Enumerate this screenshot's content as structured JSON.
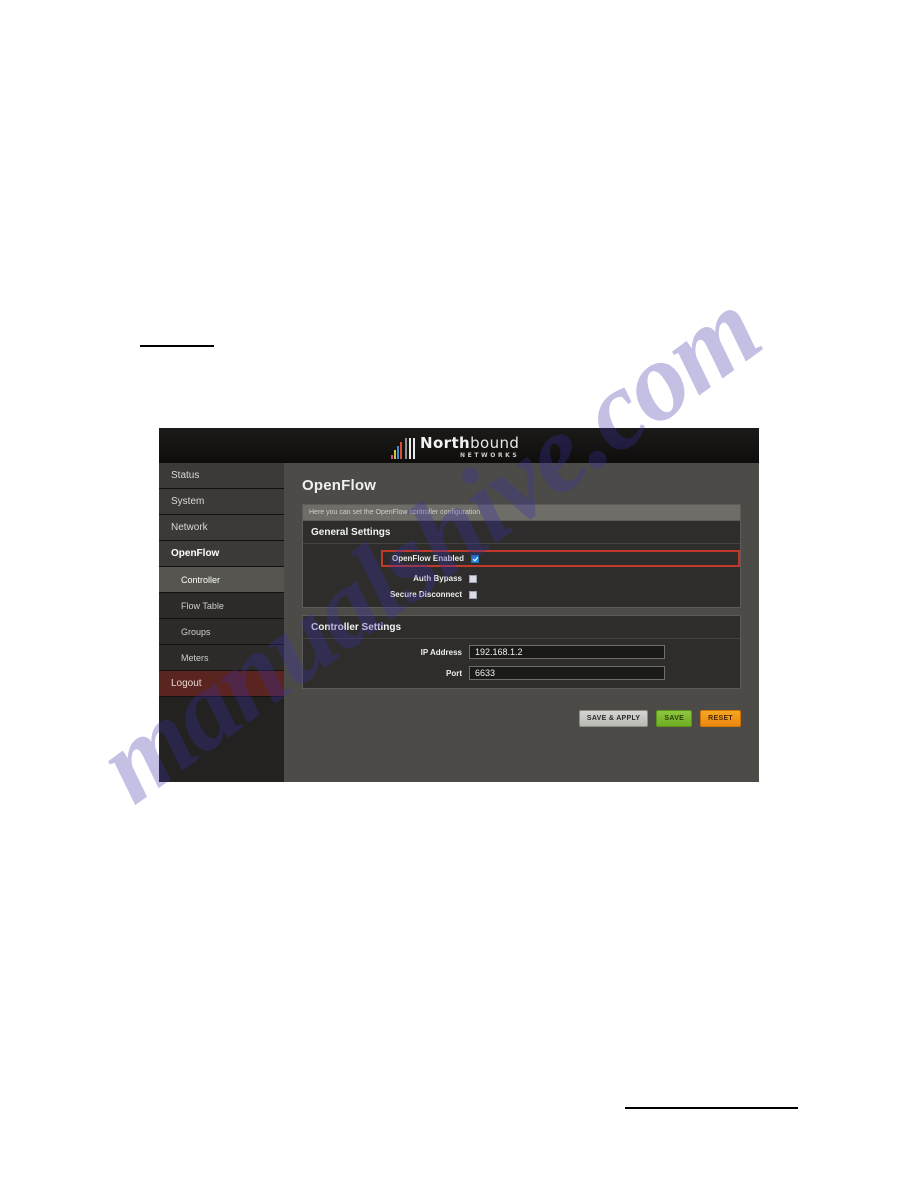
{
  "watermark": {
    "text": "manualshive.com"
  },
  "screenshot": {
    "header": {
      "brand_bold": "North",
      "brand_thin": "bound",
      "brand_sub": "NETWORKS",
      "logo_bars": [
        "#e2468f",
        "#b9cf3b",
        "#3a8fd4",
        "#e24b2e"
      ]
    },
    "sidebar": {
      "items": [
        {
          "label": "Status",
          "level": "top",
          "state": "normal"
        },
        {
          "label": "System",
          "level": "top",
          "state": "normal"
        },
        {
          "label": "Network",
          "level": "top",
          "state": "normal"
        },
        {
          "label": "OpenFlow",
          "level": "top",
          "state": "active"
        },
        {
          "label": "Controller",
          "level": "sub",
          "state": "active"
        },
        {
          "label": "Flow Table",
          "level": "sub",
          "state": "normal"
        },
        {
          "label": "Groups",
          "level": "sub",
          "state": "normal"
        },
        {
          "label": "Meters",
          "level": "sub",
          "state": "normal"
        },
        {
          "label": "Logout",
          "level": "top",
          "state": "logout"
        }
      ]
    },
    "main": {
      "page_title": "OpenFlow",
      "hint": "Here you can set the OpenFlow controller configuration",
      "general_settings": {
        "title": "General Settings",
        "fields": [
          {
            "label": "OpenFlow Enabled",
            "checked": true,
            "highlighted": true
          },
          {
            "label": "Auth Bypass",
            "checked": false,
            "highlighted": false
          },
          {
            "label": "Secure Disconnect",
            "checked": false,
            "highlighted": false
          }
        ]
      },
      "controller_settings": {
        "title": "Controller Settings",
        "fields": [
          {
            "label": "IP Address",
            "value": "192.168.1.2"
          },
          {
            "label": "Port",
            "value": "6633"
          }
        ]
      },
      "buttons": [
        {
          "label": "SAVE & APPLY",
          "style": "grey",
          "color": "#c7c7c2"
        },
        {
          "label": "SAVE",
          "style": "green",
          "color": "#7fbb2e"
        },
        {
          "label": "RESET",
          "style": "orange",
          "color": "#f29416"
        }
      ]
    }
  }
}
